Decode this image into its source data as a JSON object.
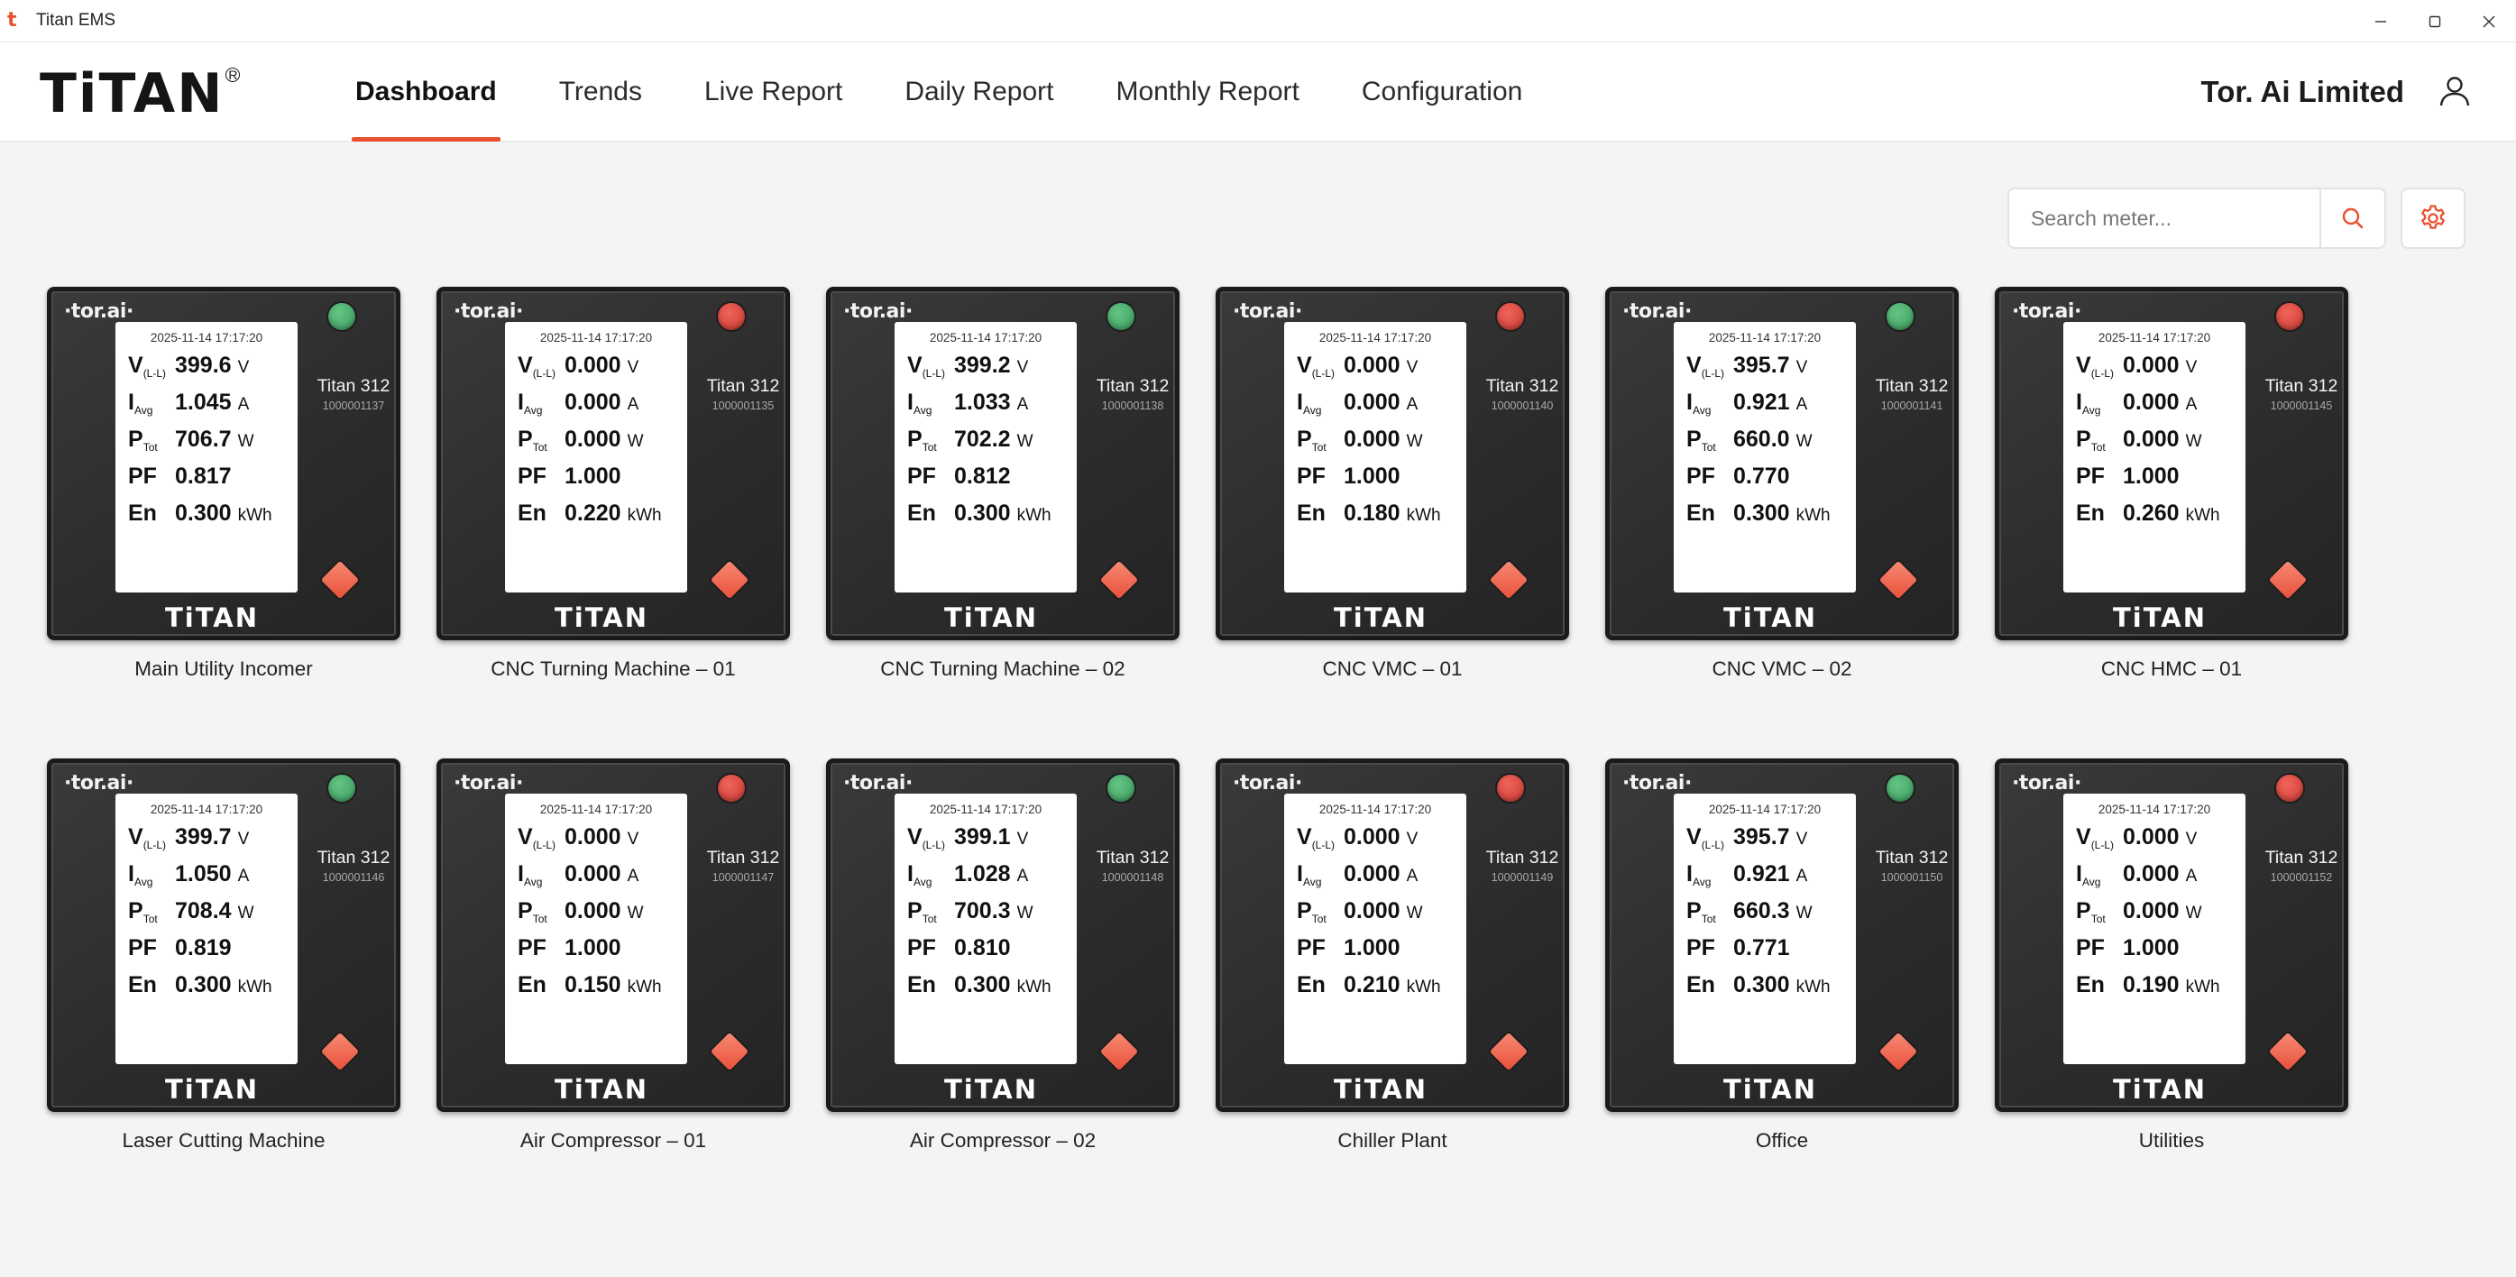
{
  "window": {
    "title": "Titan EMS",
    "controls": [
      {
        "name": "minimize-button",
        "icon": "minimize-icon"
      },
      {
        "name": "maximize-button",
        "icon": "maximize-icon"
      },
      {
        "name": "close-button",
        "icon": "close-icon"
      }
    ]
  },
  "header": {
    "logo": "TiTAN",
    "logo_reg": "R",
    "company": "Tor. Ai Limited",
    "accent": "#e8502f",
    "nav": [
      {
        "label": "Dashboard",
        "active": true
      },
      {
        "label": "Trends",
        "active": false
      },
      {
        "label": "Live Report",
        "active": false
      },
      {
        "label": "Daily Report",
        "active": false
      },
      {
        "label": "Monthly Report",
        "active": false
      },
      {
        "label": "Configuration",
        "active": false
      }
    ]
  },
  "search": {
    "placeholder": "Search meter...",
    "value": ""
  },
  "meter_labels": {
    "v": "V",
    "v_sub": "(L-L)",
    "i": "I",
    "i_sub": "Avg",
    "p": "P",
    "p_sub": "Tot",
    "pf": "PF",
    "en": "En"
  },
  "units": {
    "v": "V",
    "i": "A",
    "p": "W",
    "en": "kWh"
  },
  "device": {
    "brand_small": "·tor.ai·",
    "brand_large": "TiTAN",
    "model": "Titan 312"
  },
  "status_colors": {
    "on": "#3fa864",
    "off": "#d8453c"
  },
  "meters": [
    {
      "name": "Main Utility Incomer",
      "timestamp": "2025-11-14 17:17:20",
      "v": "399.6",
      "i": "1.045",
      "p": "706.7",
      "pf": "0.817",
      "en": "0.300",
      "serial": "1000001137",
      "status": "on"
    },
    {
      "name": "CNC Turning Machine – 01",
      "timestamp": "2025-11-14 17:17:20",
      "v": "0.000",
      "i": "0.000",
      "p": "0.000",
      "pf": "1.000",
      "en": "0.220",
      "serial": "1000001135",
      "status": "off"
    },
    {
      "name": "CNC Turning Machine – 02",
      "timestamp": "2025-11-14 17:17:20",
      "v": "399.2",
      "i": "1.033",
      "p": "702.2",
      "pf": "0.812",
      "en": "0.300",
      "serial": "1000001138",
      "status": "on"
    },
    {
      "name": "CNC VMC – 01",
      "timestamp": "2025-11-14 17:17:20",
      "v": "0.000",
      "i": "0.000",
      "p": "0.000",
      "pf": "1.000",
      "en": "0.180",
      "serial": "1000001140",
      "status": "off"
    },
    {
      "name": "CNC VMC – 02",
      "timestamp": "2025-11-14 17:17:20",
      "v": "395.7",
      "i": "0.921",
      "p": "660.0",
      "pf": "0.770",
      "en": "0.300",
      "serial": "1000001141",
      "status": "on"
    },
    {
      "name": "CNC HMC – 01",
      "timestamp": "2025-11-14 17:17:20",
      "v": "0.000",
      "i": "0.000",
      "p": "0.000",
      "pf": "1.000",
      "en": "0.260",
      "serial": "1000001145",
      "status": "off"
    },
    {
      "name": "Laser Cutting Machine",
      "timestamp": "2025-11-14 17:17:20",
      "v": "399.7",
      "i": "1.050",
      "p": "708.4",
      "pf": "0.819",
      "en": "0.300",
      "serial": "1000001146",
      "status": "on"
    },
    {
      "name": "Air Compressor – 01",
      "timestamp": "2025-11-14 17:17:20",
      "v": "0.000",
      "i": "0.000",
      "p": "0.000",
      "pf": "1.000",
      "en": "0.150",
      "serial": "1000001147",
      "status": "off"
    },
    {
      "name": "Air Compressor – 02",
      "timestamp": "2025-11-14 17:17:20",
      "v": "399.1",
      "i": "1.028",
      "p": "700.3",
      "pf": "0.810",
      "en": "0.300",
      "serial": "1000001148",
      "status": "on"
    },
    {
      "name": "Chiller Plant",
      "timestamp": "2025-11-14 17:17:20",
      "v": "0.000",
      "i": "0.000",
      "p": "0.000",
      "pf": "1.000",
      "en": "0.210",
      "serial": "1000001149",
      "status": "off"
    },
    {
      "name": "Office",
      "timestamp": "2025-11-14 17:17:20",
      "v": "395.7",
      "i": "0.921",
      "p": "660.3",
      "pf": "0.771",
      "en": "0.300",
      "serial": "1000001150",
      "status": "on"
    },
    {
      "name": "Utilities",
      "timestamp": "2025-11-14 17:17:20",
      "v": "0.000",
      "i": "0.000",
      "p": "0.000",
      "pf": "1.000",
      "en": "0.190",
      "serial": "1000001152",
      "status": "off"
    }
  ]
}
